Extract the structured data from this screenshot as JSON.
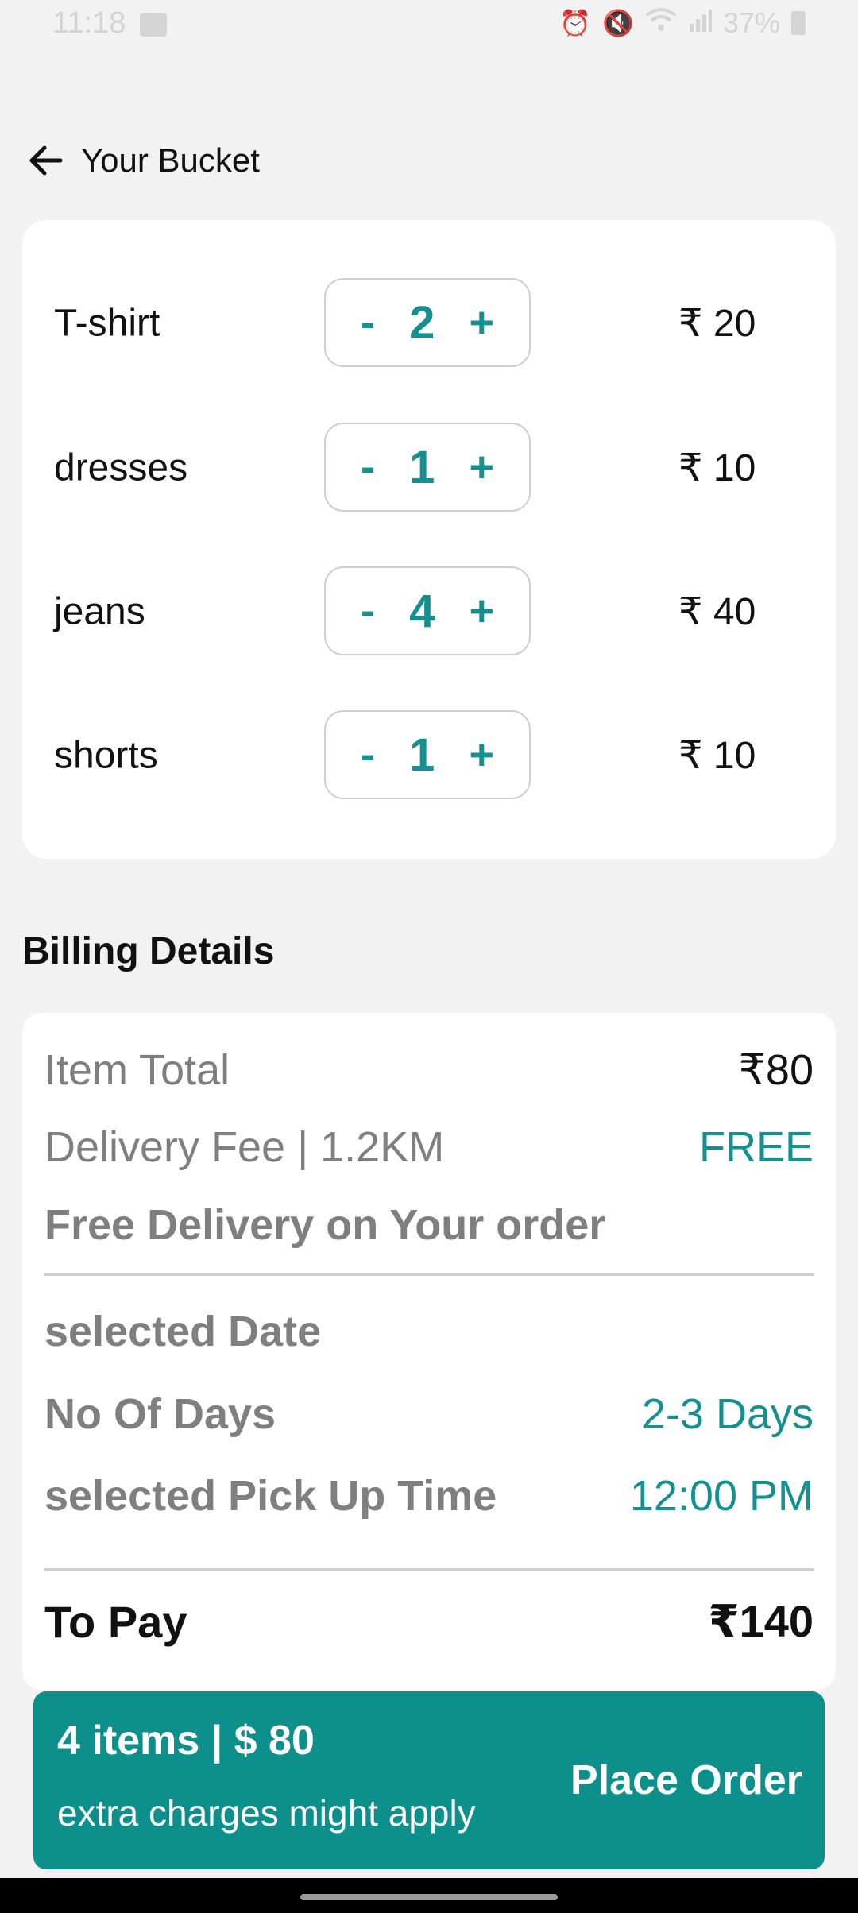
{
  "status_bar": {
    "time": "11:18",
    "battery": "37%",
    "icons": [
      "image-icon",
      "alarm-icon",
      "mute-icon",
      "wifi-icon",
      "volte-icon",
      "signal-icon",
      "battery-icon"
    ]
  },
  "header": {
    "back_icon": "arrow-left-icon",
    "title": "Your Bucket"
  },
  "cart": {
    "items": [
      {
        "name": "T-shirt",
        "minus": "-",
        "qty": "2",
        "plus": "+",
        "price": "₹ 20"
      },
      {
        "name": "dresses",
        "minus": "-",
        "qty": "1",
        "plus": "+",
        "price": "₹ 10"
      },
      {
        "name": "jeans",
        "minus": "-",
        "qty": "4",
        "plus": "+",
        "price": "₹ 40"
      },
      {
        "name": "shorts",
        "minus": "-",
        "qty": "1",
        "plus": "+",
        "price": "₹ 10"
      }
    ]
  },
  "billing": {
    "heading": "Billing Details",
    "item_total_label": "Item Total",
    "item_total_value": "₹80",
    "delivery_label": "Delivery Fee | 1.2KM",
    "delivery_value": "FREE",
    "free_delivery_note": "Free Delivery on Your order",
    "selected_date_label": "selected Date",
    "days_label": "No Of Days",
    "days_value": "2-3 Days",
    "pickup_label": "selected Pick Up Time",
    "pickup_value": "12:00 PM",
    "to_pay_label": "To Pay",
    "to_pay_value": "₹140"
  },
  "order_bar": {
    "summary": "4 items | $ 80",
    "note": "extra charges might apply",
    "button": "Place Order"
  },
  "colors": {
    "accent": "#149090",
    "order_bar": "#0d8f8b",
    "background": "#f2f2f2"
  }
}
